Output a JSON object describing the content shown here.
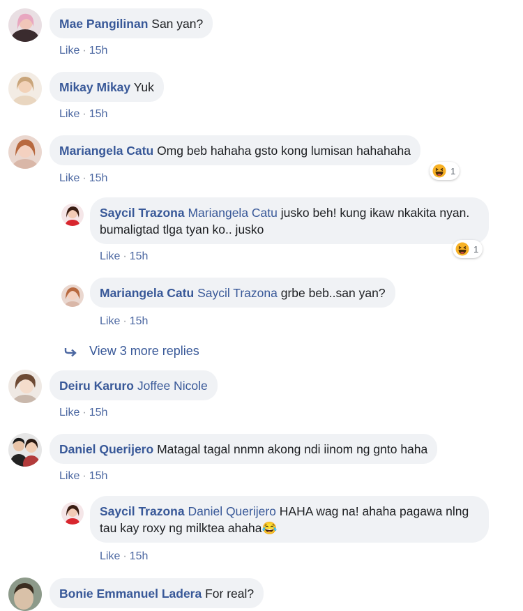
{
  "comments": [
    {
      "author": "Mae Pangilinan",
      "mention": "",
      "text": "San yan?",
      "like": "Like",
      "time": "15h"
    },
    {
      "author": "Mikay Mikay",
      "mention": "",
      "text": "Yuk",
      "like": "Like",
      "time": "15h"
    },
    {
      "author": "Mariangela Catu",
      "mention": "",
      "text": "Omg beb hahaha gsto kong lumisan hahahaha",
      "like": "Like",
      "time": "15h",
      "reaction_count": "1"
    },
    {
      "author": "Saycil Trazona",
      "mention": "Mariangela Catu",
      "text": "jusko beh! kung ikaw nkakita nyan. bumaligtad tlga tyan ko.. jusko",
      "like": "Like",
      "time": "15h",
      "reaction_count": "1"
    },
    {
      "author": "Mariangela Catu",
      "mention": "Saycil Trazona",
      "text": "grbe beb..san yan?",
      "like": "Like",
      "time": "15h"
    },
    {
      "author": "Deiru Karuro",
      "mention": "Joffee Nicole",
      "text": "",
      "like": "Like",
      "time": "15h"
    },
    {
      "author": "Daniel Querijero",
      "mention": "",
      "text": "Matagal tagal nnmn akong ndi iinom ng gnto haha",
      "like": "Like",
      "time": "15h"
    },
    {
      "author": "Saycil Trazona",
      "mention": "Daniel Querijero",
      "text": "HAHA wag na! ahaha pagawa nlng tau kay roxy ng milktea ahaha",
      "emoji": "😂",
      "like": "Like",
      "time": "15h"
    },
    {
      "author": "Bonie Emmanuel Ladera",
      "mention": "",
      "text": "For real?"
    }
  ],
  "view_more_replies": "View 3 more replies",
  "colors": {
    "name": "#385898",
    "bubble": "#f0f2f5",
    "meta": "#4b67a1"
  }
}
